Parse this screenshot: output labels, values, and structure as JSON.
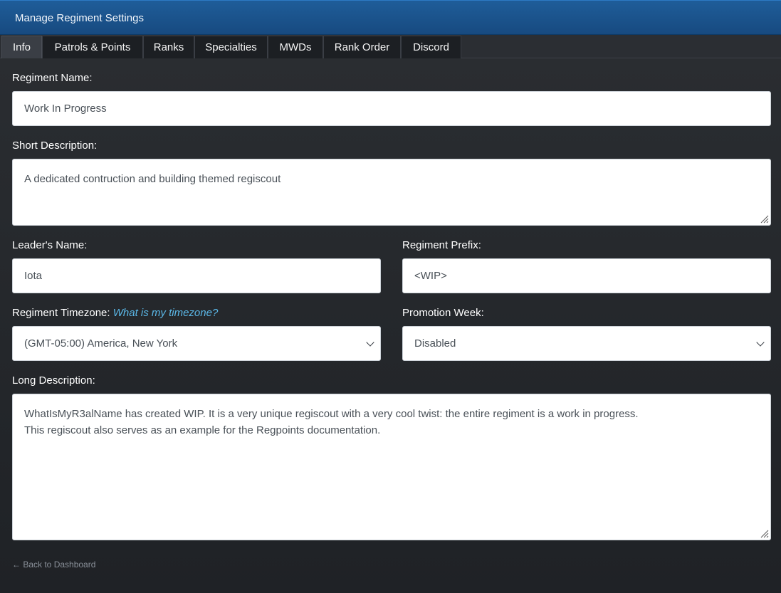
{
  "header": {
    "title": "Manage Regiment Settings"
  },
  "tabs": [
    {
      "label": "Info",
      "active": true
    },
    {
      "label": "Patrols & Points",
      "active": false
    },
    {
      "label": "Ranks",
      "active": false
    },
    {
      "label": "Specialties",
      "active": false
    },
    {
      "label": "MWDs",
      "active": false
    },
    {
      "label": "Rank Order",
      "active": false
    },
    {
      "label": "Discord",
      "active": false
    }
  ],
  "form": {
    "regiment_name": {
      "label": "Regiment Name:",
      "value": "Work In Progress"
    },
    "short_description": {
      "label": "Short Description:",
      "value": "A dedicated contruction and building themed regiscout"
    },
    "leader_name": {
      "label": "Leader's Name:",
      "value": "Iota"
    },
    "regiment_prefix": {
      "label": "Regiment Prefix:",
      "value": "<WIP>"
    },
    "timezone": {
      "label": "Regiment Timezone:",
      "help_link": "What is my timezone?",
      "value": "(GMT-05:00) America, New York"
    },
    "promotion_week": {
      "label": "Promotion Week:",
      "value": "Disabled"
    },
    "long_description": {
      "label": "Long Description:",
      "value": "WhatIsMyR3alName has created WIP. It is a very unique regiscout with a very cool twist: the entire regiment is a work in progress.\nThis regiscout also serves as an example for the Regpoints documentation."
    }
  },
  "footer": {
    "back_link": "← Back to Dashboard"
  },
  "colors": {
    "header_blue": "#1a5189",
    "link_blue": "#5bb8e8",
    "background": "#25282c"
  }
}
